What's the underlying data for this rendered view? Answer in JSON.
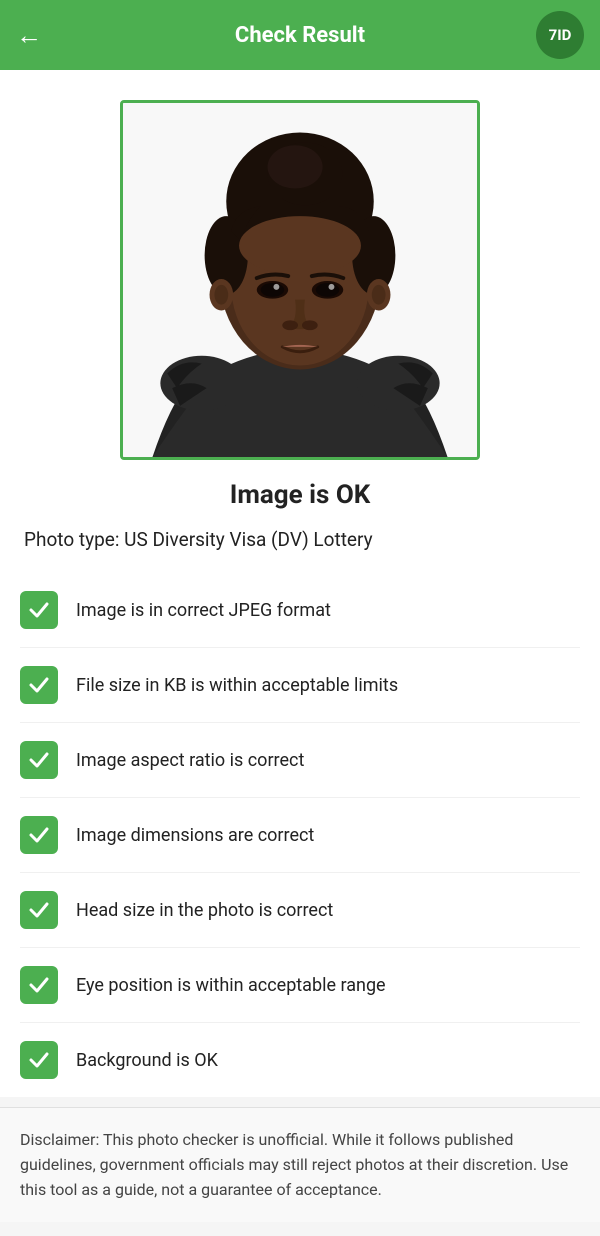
{
  "header": {
    "title": "Check Result",
    "back_icon": "←",
    "logo_text": "7ID"
  },
  "photo": {
    "alt": "Passport photo of a young woman"
  },
  "status": {
    "title": "Image is OK"
  },
  "photo_type_label": "Photo type: US Diversity Visa (DV) Lottery",
  "checks": [
    {
      "id": "jpeg",
      "label": "Image is in correct JPEG format",
      "passed": true
    },
    {
      "id": "filesize",
      "label": "File size in KB is within acceptable limits",
      "passed": true
    },
    {
      "id": "aspect",
      "label": "Image aspect ratio is correct",
      "passed": true
    },
    {
      "id": "dimensions",
      "label": "Image dimensions are correct",
      "passed": true
    },
    {
      "id": "headsize",
      "label": "Head size in the photo is correct",
      "passed": true
    },
    {
      "id": "eyepos",
      "label": "Eye position is within acceptable range",
      "passed": true
    },
    {
      "id": "background",
      "label": "Background is OK",
      "passed": true
    }
  ],
  "disclaimer": "Disclaimer: This photo checker is unofficial. While it follows published guidelines, government officials may still reject photos at their discretion. Use this tool as a guide, not a guarantee of acceptance."
}
